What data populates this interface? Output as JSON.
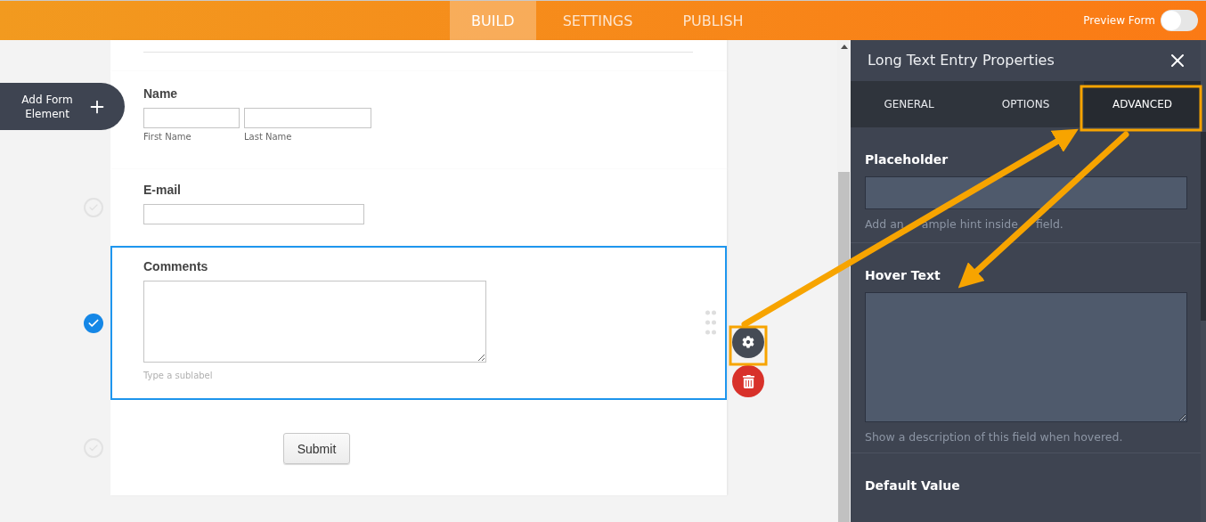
{
  "top_bar": {
    "nav": [
      {
        "label": "BUILD",
        "selected": true
      },
      {
        "label": "SETTINGS",
        "selected": false
      },
      {
        "label": "PUBLISH",
        "selected": false
      }
    ],
    "preview_toggle": {
      "label": "Preview Form",
      "on": false
    }
  },
  "add_element_button": {
    "label": "Add Form Element"
  },
  "form": {
    "fields": [
      {
        "kind": "name",
        "label": "Name",
        "selected": false,
        "sublabels": [
          "First Name",
          "Last Name"
        ]
      },
      {
        "kind": "email",
        "label": "E-mail",
        "checked": false,
        "selected": false
      },
      {
        "kind": "textarea",
        "label": "Comments",
        "checked": true,
        "selected": true,
        "sublabel": "Type a sublabel"
      },
      {
        "kind": "submit",
        "label": "Submit",
        "checked": false,
        "selected": false
      }
    ]
  },
  "properties_panel": {
    "title": "Long Text Entry Properties",
    "tabs": [
      {
        "label": "GENERAL",
        "selected": false
      },
      {
        "label": "OPTIONS",
        "selected": false
      },
      {
        "label": "ADVANCED",
        "selected": true
      }
    ],
    "sections": [
      {
        "kind": "input",
        "label": "Placeholder",
        "hint_parts": [
          "Add an",
          "ample hint inside",
          "field."
        ]
      },
      {
        "kind": "textarea",
        "label": "Hover Text",
        "hint": "Show a description of this field when hovered."
      },
      {
        "kind": "heading",
        "label": "Default Value"
      }
    ]
  }
}
